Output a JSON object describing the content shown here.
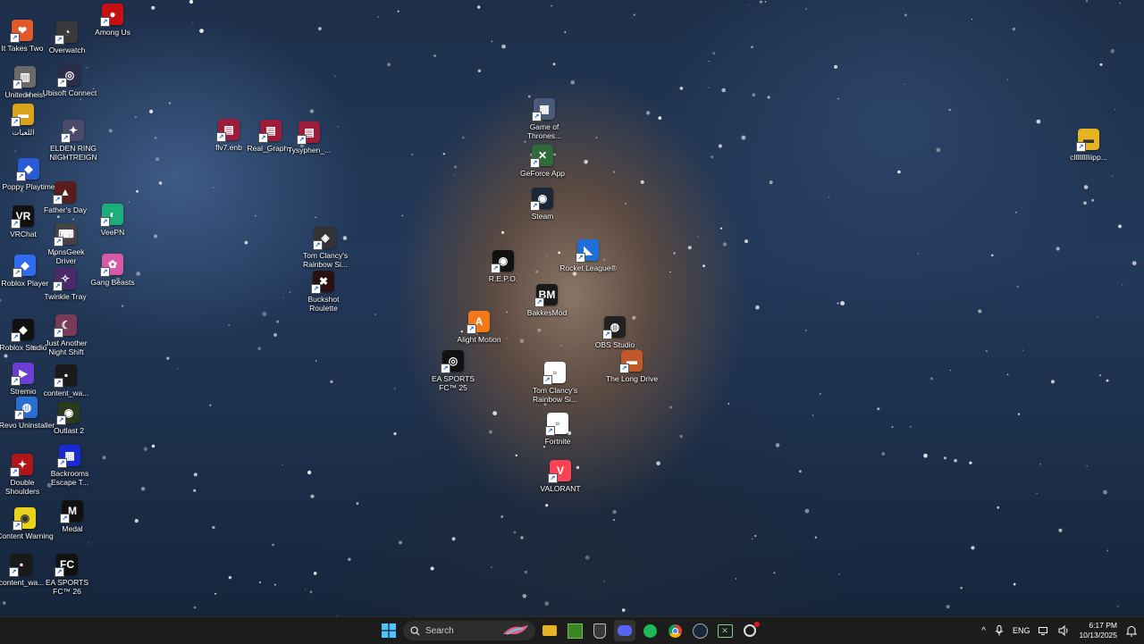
{
  "desktop_icons": [
    {
      "label": "It Takes Two",
      "color": "#e05a2b",
      "glyph": "❤"
    },
    {
      "label": "Overwatch",
      "color": "#3a3a3a",
      "glyph": "◔"
    },
    {
      "label": "Among Us",
      "color": "#c51111",
      "glyph": "●"
    },
    {
      "label": "United heist",
      "color": "#6a6a6a",
      "glyph": "▥"
    },
    {
      "label": "Ubisoft Connect",
      "color": "#2b2b4a",
      "glyph": "◎"
    },
    {
      "label": "اللعبات",
      "color": "#d9a21b",
      "glyph": "▬"
    },
    {
      "label": "ELDEN RING NIGHTREIGN",
      "color": "#4a4a6a",
      "glyph": "✦"
    },
    {
      "label": "flv7.enb",
      "color": "#9b1d3a",
      "glyph": "▤"
    },
    {
      "label": "Real_Graph...",
      "color": "#9b1d3a",
      "glyph": "▤"
    },
    {
      "label": "Tysyphen_...",
      "color": "#9b1d3a",
      "glyph": "▤"
    },
    {
      "label": "Game of Thrones...",
      "color": "#4a5a7a",
      "glyph": "▦"
    },
    {
      "label": "GeForce App",
      "color": "#2f6b3b",
      "glyph": "✕"
    },
    {
      "label": "cllllllllliipp...",
      "color": "#e6b422",
      "glyph": "▬"
    },
    {
      "label": "Poppy Playtime",
      "color": "#2a5bd7",
      "glyph": "◆"
    },
    {
      "label": "Father's Day",
      "color": "#5a1c1c",
      "glyph": "▲"
    },
    {
      "label": "Steam",
      "color": "#1b2838",
      "glyph": "◉"
    },
    {
      "label": "VRChat",
      "color": "#111111",
      "glyph": "VR"
    },
    {
      "label": "VeePN",
      "color": "#1cae7a",
      "glyph": "◐"
    },
    {
      "label": "MonsGeek Driver",
      "color": "#444444",
      "glyph": "⌨"
    },
    {
      "label": "Tom Clancy's Rainbow Si...",
      "color": "#333333",
      "glyph": "◈"
    },
    {
      "label": "Rocket League®",
      "color": "#1e6fd8",
      "glyph": "◣"
    },
    {
      "label": "Roblox Player",
      "color": "#2f6cf0",
      "glyph": "◆"
    },
    {
      "label": "Twinkle Tray",
      "color": "#4b2a6a",
      "glyph": "✧"
    },
    {
      "label": "Gang Beasts",
      "color": "#d65aa8",
      "glyph": "✿"
    },
    {
      "label": "Buckshot Roulette",
      "color": "#2a1010",
      "glyph": "✖"
    },
    {
      "label": "R.E.P.O.",
      "color": "#111111",
      "glyph": "◉"
    },
    {
      "label": "BakkesMod",
      "color": "#1a1a1a",
      "glyph": "BM"
    },
    {
      "label": "Roblox Studio",
      "color": "#111111",
      "glyph": "◆"
    },
    {
      "label": "Just Another Night Shift",
      "color": "#7a3a5a",
      "glyph": "☾"
    },
    {
      "label": "Alight Motion",
      "color": "#f07a1a",
      "glyph": "A"
    },
    {
      "label": "OBS Studio",
      "color": "#222222",
      "glyph": "◍"
    },
    {
      "label": "Stremio",
      "color": "#6b3fd6",
      "glyph": "▶"
    },
    {
      "label": "content_wa...",
      "color": "#1a1a1a",
      "glyph": "▪"
    },
    {
      "label": "EA SPORTS FC™ 25",
      "color": "#111111",
      "glyph": "◎"
    },
    {
      "label": "Tom Clancy's Rainbow Si...",
      "color": "#ffffff",
      "glyph": "▫"
    },
    {
      "label": "The Long Drive",
      "color": "#c0582a",
      "glyph": "▬"
    },
    {
      "label": "Revo Uninstaller",
      "color": "#2a6fd0",
      "glyph": "◍"
    },
    {
      "label": "Outlast 2",
      "color": "#2a3a1a",
      "glyph": "◉"
    },
    {
      "label": "Fortnite",
      "color": "#ffffff",
      "glyph": "▫"
    },
    {
      "label": "Double Shoulders",
      "color": "#b0151a",
      "glyph": "✦"
    },
    {
      "label": "Backrooms Escape T...",
      "color": "#1a2ad0",
      "glyph": "▦"
    },
    {
      "label": "VALORANT",
      "color": "#fa4454",
      "glyph": "V"
    },
    {
      "label": "Content Warning",
      "color": "#e8d21a",
      "glyph": "◉"
    },
    {
      "label": "Medal",
      "color": "#111111",
      "glyph": "M"
    },
    {
      "label": "content_wa...",
      "color": "#1a1a1a",
      "glyph": "▪"
    },
    {
      "label": "EA SPORTS FC™ 26",
      "color": "#111111",
      "glyph": "FC"
    }
  ],
  "taskbar": {
    "search_label": "Search",
    "apps": [
      {
        "name": "file-explorer",
        "color": "#e6b422",
        "glyph": "▬"
      },
      {
        "name": "minecraft",
        "color": "#3c8527",
        "glyph": "▦"
      },
      {
        "name": "epic-games",
        "color": "#3a3a3a",
        "glyph": "◇"
      },
      {
        "name": "discord",
        "color": "#5865f2",
        "glyph": "◉"
      },
      {
        "name": "spotify",
        "color": "#1db954",
        "glyph": "≋"
      },
      {
        "name": "chrome",
        "color": "#db4437",
        "glyph": "◍"
      },
      {
        "name": "steam",
        "color": "#1b2838",
        "glyph": "◉"
      },
      {
        "name": "xbox",
        "color": "#2a2a2a",
        "glyph": "✕"
      },
      {
        "name": "medal",
        "color": "#2a2a2a",
        "glyph": "◎"
      }
    ],
    "tray": {
      "language": "ENG",
      "time": "6:17 PM",
      "date": "10/13/2025"
    }
  }
}
